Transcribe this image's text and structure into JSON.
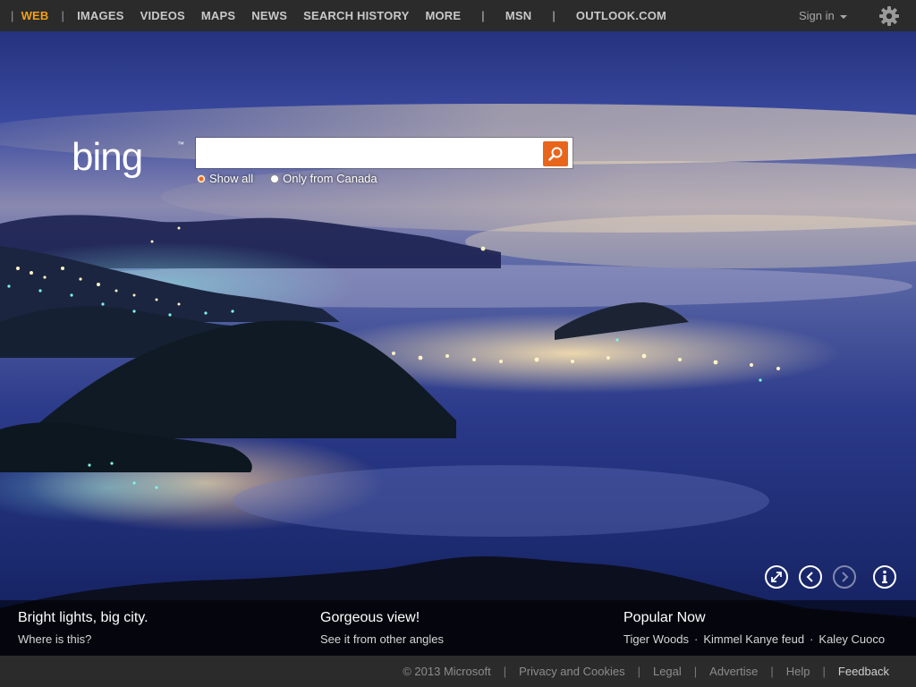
{
  "nav": {
    "items": [
      "WEB",
      "IMAGES",
      "VIDEOS",
      "MAPS",
      "NEWS",
      "SEARCH HISTORY",
      "MORE"
    ],
    "extra": [
      "MSN",
      "OUTLOOK.COM"
    ]
  },
  "header": {
    "sign_in": "Sign in",
    "settings_icon": "gear-icon"
  },
  "logo": {
    "text": "bing",
    "trademark": "™"
  },
  "search": {
    "value": "",
    "placeholder": "",
    "button_icon": "search-icon"
  },
  "radios": {
    "all": "Show all",
    "local": "Only from Canada",
    "selected": "Show all"
  },
  "controls": [
    "expand-icon",
    "previous-icon",
    "next-icon",
    "info-icon"
  ],
  "captions": {
    "left": {
      "title": "Bright lights, big city.",
      "link": "Where is this?"
    },
    "middle": {
      "title": "Gorgeous view!",
      "link": "See it from other angles"
    },
    "right": {
      "title": "Popular Now",
      "links": [
        "Tiger Woods",
        "Kimmel Kanye feud",
        "Kaley Cuoco"
      ]
    }
  },
  "footer": {
    "copyright": "© 2013 Microsoft",
    "links": [
      "Privacy and Cookies",
      "Legal",
      "Advertise",
      "Help",
      "Feedback"
    ]
  },
  "colors": {
    "topbar": "#2b2b2b",
    "active": "#f4a019",
    "accent": "#e8651c"
  }
}
